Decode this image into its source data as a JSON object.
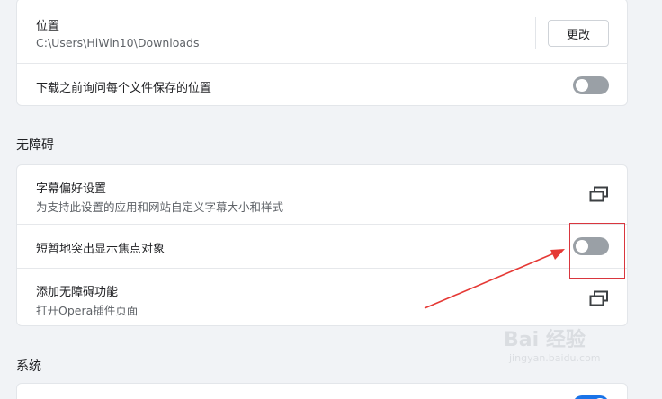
{
  "download_location": {
    "label": "位置",
    "path": "C:\\Users\\HiWin10\\Downloads",
    "change_button": "更改"
  },
  "ask_before_download": {
    "label": "下载之前询问每个文件保存的位置",
    "enabled": false
  },
  "accessibility": {
    "section_title": "无障碍",
    "caption_prefs": {
      "label": "字幕偏好设置",
      "description": "为支持此设置的应用和网站自定义字幕大小和样式",
      "icon": "external-window-icon"
    },
    "focus_highlight": {
      "label": "短暂地突出显示焦点对象",
      "enabled": false
    },
    "add_features": {
      "label": "添加无障碍功能",
      "description": "打开Opera插件页面",
      "icon": "external-window-icon"
    }
  },
  "system": {
    "section_title": "系统"
  },
  "colors": {
    "toggle_off": "#9aa0a6",
    "toggle_on": "#1a73e8",
    "annotation_red": "#d9363e"
  },
  "watermark": {
    "brand": "Bai 经验",
    "domain": "jingyan.baidu.com"
  }
}
